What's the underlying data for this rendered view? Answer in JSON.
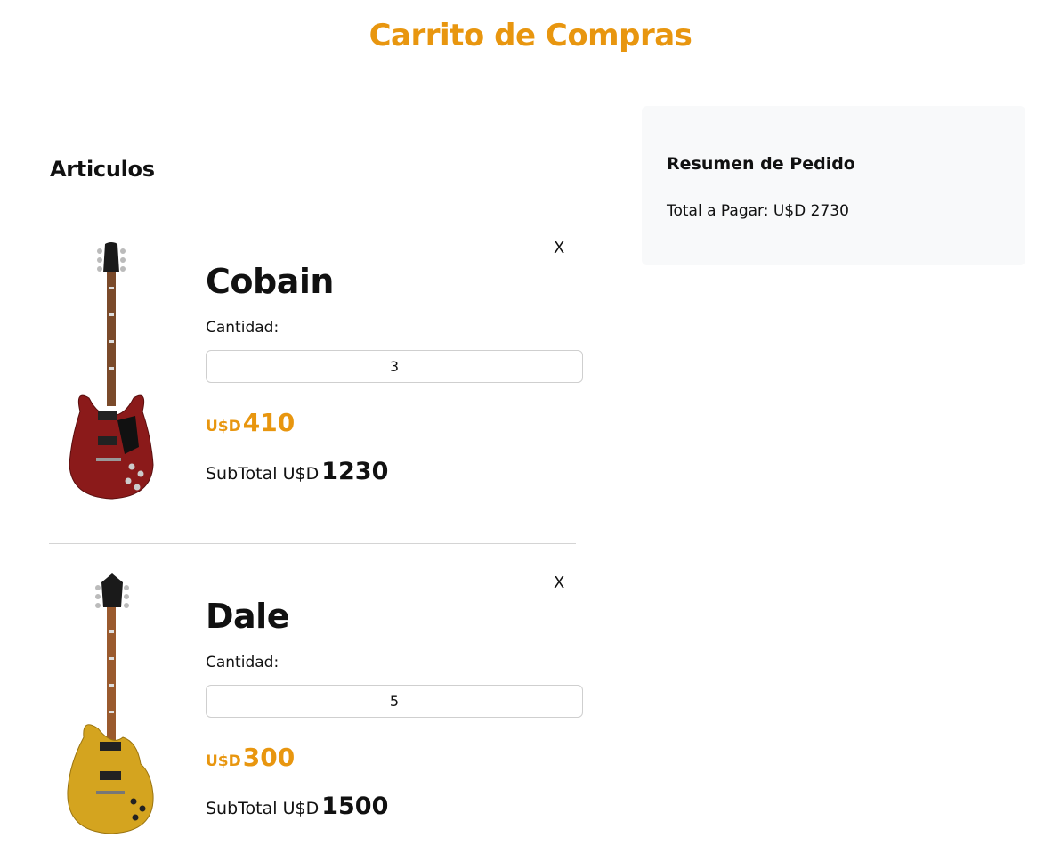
{
  "page": {
    "title": "Carrito de Compras"
  },
  "articles": {
    "heading": "Articulos",
    "items": [
      {
        "name": "Cobain",
        "quantity_label": "Cantidad:",
        "quantity": "3",
        "price_currency": "U$D",
        "price": "410",
        "subtotal_label": "SubTotal U$D",
        "subtotal": "1230",
        "remove_label": "X",
        "body_color": "#8b1a1a"
      },
      {
        "name": "Dale",
        "quantity_label": "Cantidad:",
        "quantity": "5",
        "price_currency": "U$D",
        "price": "300",
        "subtotal_label": "SubTotal U$D",
        "subtotal": "1500",
        "remove_label": "X",
        "body_color": "#d4a41f"
      }
    ]
  },
  "summary": {
    "title": "Resumen de Pedido",
    "total_label": "Total a Pagar: U$D 2730"
  },
  "colors": {
    "accent": "#e8960f",
    "summary_bg": "#f8f9fa"
  }
}
